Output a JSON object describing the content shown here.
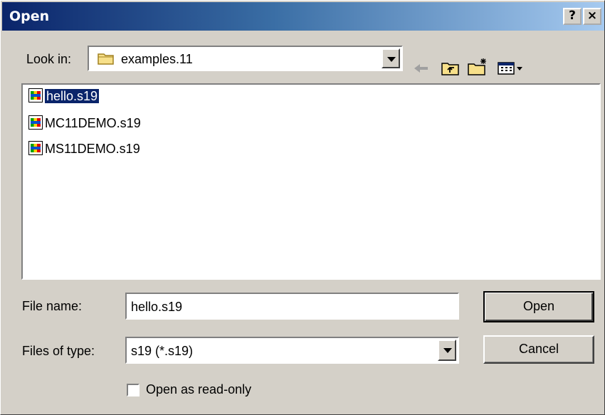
{
  "dialog": {
    "title": "Open",
    "help_button": "?",
    "close_button": "×"
  },
  "look_in": {
    "label": "Look in:",
    "value": "examples.11"
  },
  "toolbar": {
    "icons": [
      "back-arrow-icon",
      "up-folder-icon",
      "new-folder-icon",
      "view-menu-icon"
    ]
  },
  "files": [
    {
      "name": "hello.s19",
      "selected": true
    },
    {
      "name": "MC11DEMO.s19",
      "selected": false
    },
    {
      "name": "MS11DEMO.s19",
      "selected": false
    }
  ],
  "file_name": {
    "label": "File name:",
    "value": "hello.s19"
  },
  "file_type": {
    "label": "Files of type:",
    "value": "s19 (*.s19)"
  },
  "buttons": {
    "open": "Open",
    "cancel": "Cancel"
  },
  "read_only": {
    "label": "Open as read-only",
    "checked": false
  }
}
